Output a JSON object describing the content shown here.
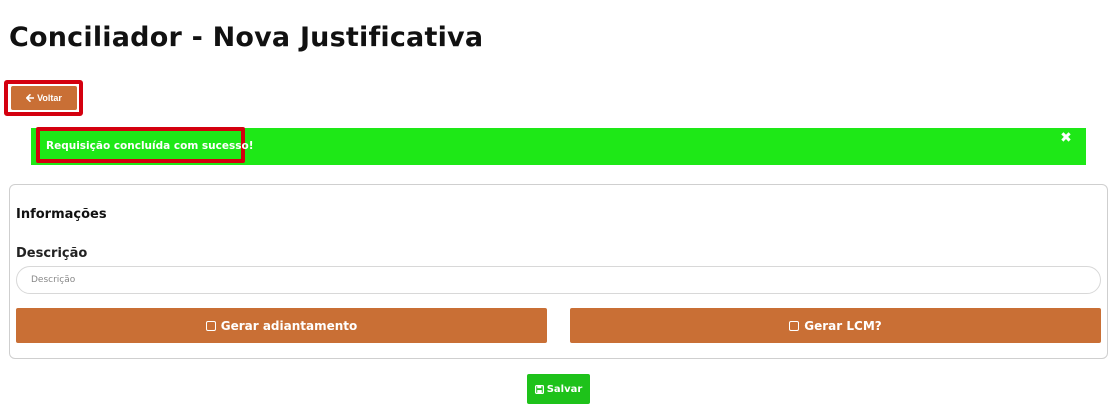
{
  "page": {
    "title": "Conciliador - Nova Justificativa"
  },
  "toolbar": {
    "back_label": "Voltar",
    "back_icon": "arrow-left-icon"
  },
  "alert": {
    "message": "Requisição concluída com sucesso!",
    "close_glyph": "✖",
    "color": "#1ee817"
  },
  "form": {
    "section_title": "Informações",
    "description": {
      "label": "Descrição",
      "placeholder": "Descrição",
      "value": ""
    },
    "buttons": {
      "adiantamento": "Gerar adiantamento",
      "lcm": "Gerar LCM?"
    }
  },
  "footer": {
    "save_label": "Salvar",
    "save_icon": "floppy-disk-icon",
    "save_color": "#1ec21a"
  },
  "colors": {
    "accent": "#c96f35",
    "highlight": "#d4000f"
  }
}
